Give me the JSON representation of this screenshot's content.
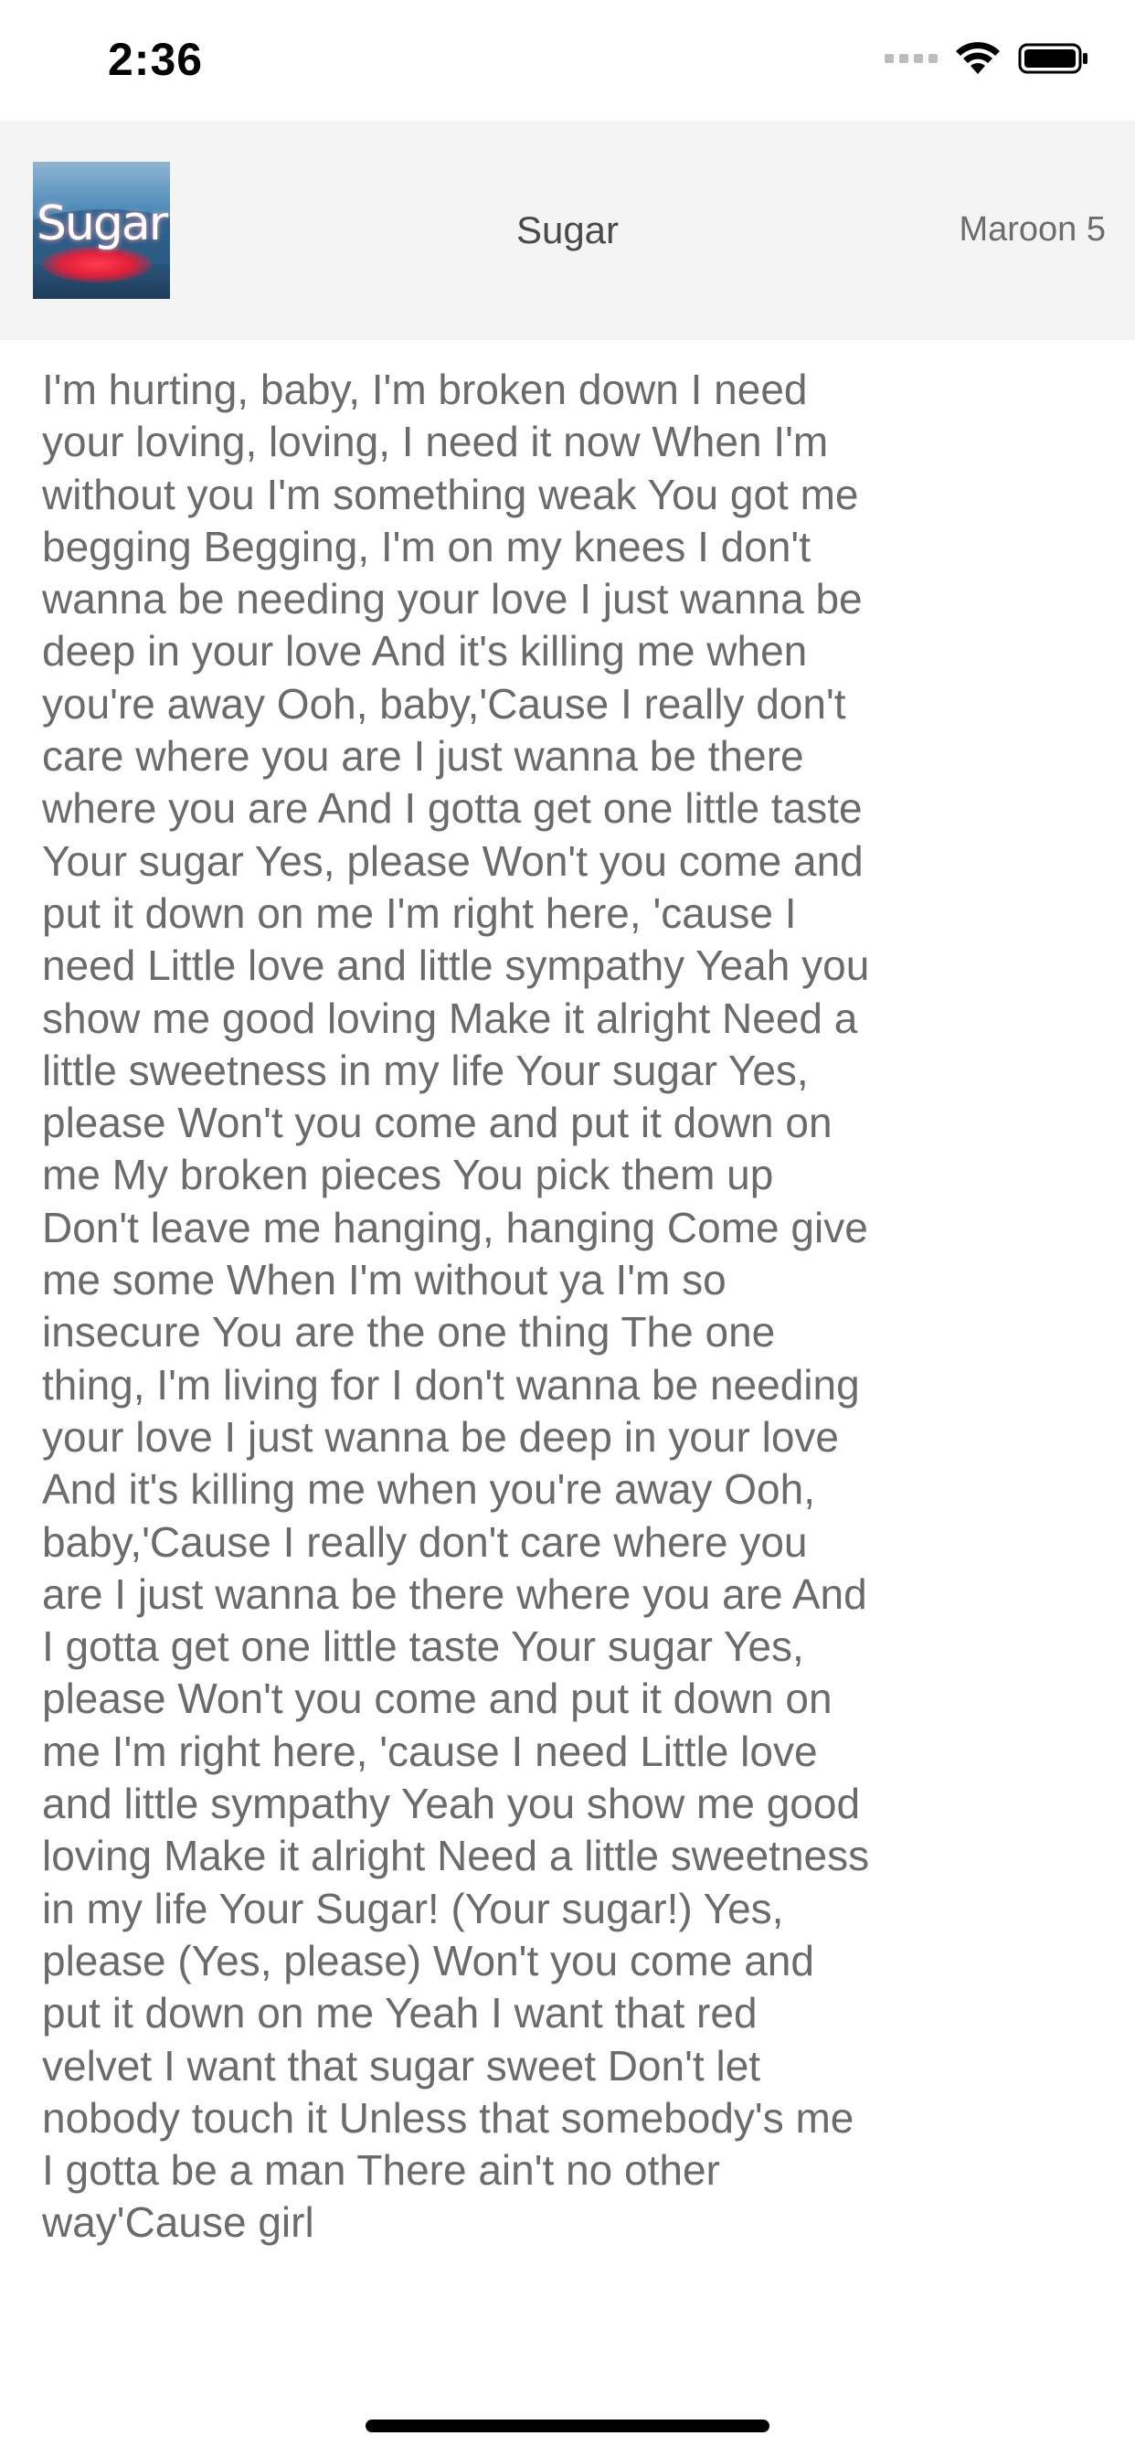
{
  "status_bar": {
    "time": "2:36",
    "signal_icon": "cellular-signal-icon",
    "wifi_icon": "wifi-icon",
    "battery_icon": "battery-icon"
  },
  "header": {
    "album_art_text": "Sugar",
    "title": "Sugar",
    "artist": "Maroon 5"
  },
  "lyrics": {
    "text": "I'm hurting, baby, I'm broken down I need your loving, loving, I need it now When I'm without you I'm something weak You got me begging Begging, I'm on my knees I don't wanna be needing your love I just wanna be deep in your love And it's killing me when you're away Ooh, baby,'Cause I really don't care where you are I just wanna be there where you are And I gotta get one little taste Your sugar Yes, please Won't you come and put it down on me I'm right here, 'cause I need Little love and little sympathy Yeah you show me good loving Make it alright Need a little sweetness in my life Your sugar Yes, please Won't you come and put it down on me My broken pieces You pick them up Don't leave me hanging, hanging Come give me some When I'm without ya I'm so insecure You are the one thing The one thing, I'm living for I don't wanna be needing your love I just wanna be deep in your love And it's killing me when you're away Ooh, baby,'Cause I really don't care where you are I just wanna be there where you are And I gotta get one little taste Your sugar Yes, please Won't you come and put it down on me I'm right here, 'cause I need Little love and little sympathy Yeah you show me good loving Make it alright Need a little sweetness in my life Your Sugar! (Your sugar!) Yes, please (Yes, please) Won't you come and put it down on me Yeah I want that red velvet I want that sugar sweet Don't let nobody touch it Unless that somebody's me I gotta be a man There ain't no other way'Cause girl"
  },
  "colors": {
    "header_background": "#f4f4f4",
    "title_text": "#4a4a4a",
    "artist_text": "#6d6d6d",
    "lyrics_text": "#6b6b6b",
    "home_indicator": "#000000"
  }
}
